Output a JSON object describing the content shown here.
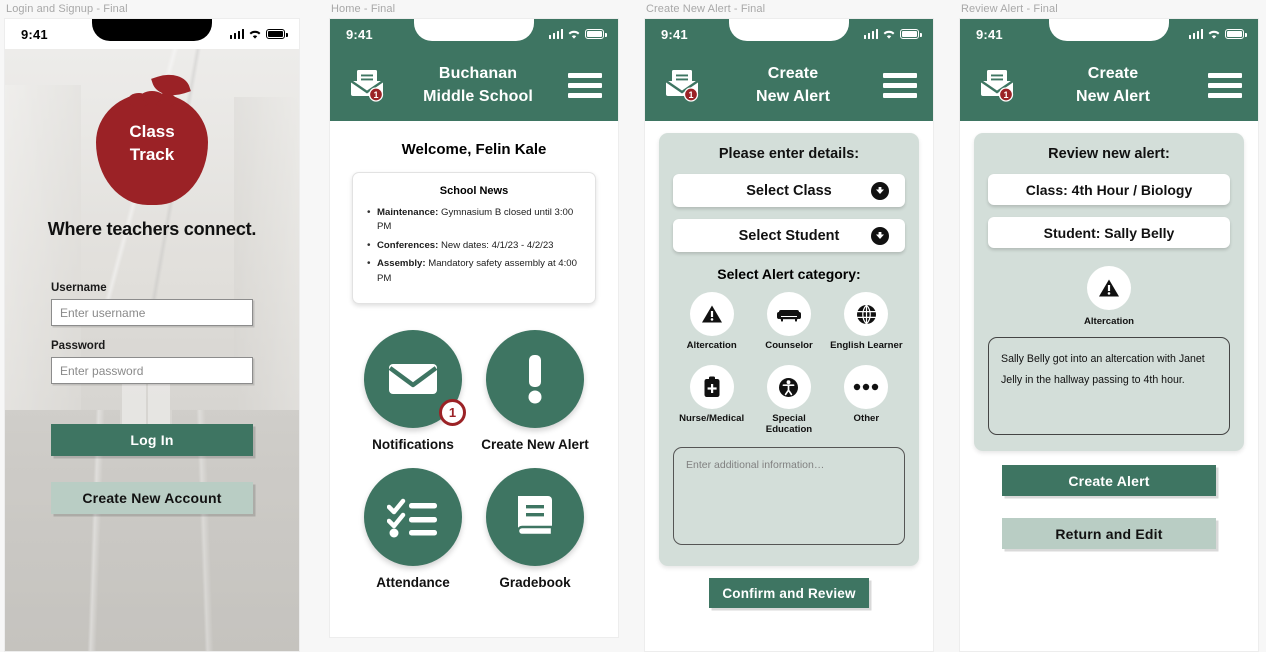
{
  "frames": [
    {
      "title": "Login and Signup - Final"
    },
    {
      "title": "Home - Final"
    },
    {
      "title": "Create New Alert - Final"
    },
    {
      "title": "Review Alert - Final"
    }
  ],
  "status_bar": {
    "time": "9:41"
  },
  "colors": {
    "green": "#3e7562",
    "green_light": "#b9cdc4",
    "panel": "#d3ded9",
    "red": "#9b2226"
  },
  "login": {
    "logo_line1": "Class",
    "logo_line2": "Track",
    "tagline": "Where teachers connect.",
    "username_label": "Username",
    "username_placeholder": "Enter username",
    "password_label": "Password",
    "password_placeholder": "Enter password",
    "login_button": "Log In",
    "create_account_button": "Create New Account"
  },
  "home": {
    "header_line1": "Buchanan",
    "header_line2": "Middle School",
    "welcome": "Welcome, Felin Kale",
    "news_title": "School News",
    "news": [
      {
        "label": "Maintenance:",
        "text": " Gymnasium B closed until 3:00 PM"
      },
      {
        "label": "Conferences:",
        "text": " New dates: 4/1/23 - 4/2/23"
      },
      {
        "label": "Assembly:",
        "text": " Mandatory safety assembly at 4:00 PM"
      }
    ],
    "tiles": [
      {
        "label": "Notifications",
        "icon": "envelope-icon",
        "badge": "1"
      },
      {
        "label": "Create New Alert",
        "icon": "exclamation-icon",
        "badge": ""
      },
      {
        "label": "Attendance",
        "icon": "checklist-icon",
        "badge": ""
      },
      {
        "label": "Gradebook",
        "icon": "book-icon",
        "badge": ""
      }
    ]
  },
  "create_alert": {
    "header_line1": "Create",
    "header_line2": "New Alert",
    "panel_title": "Please enter details:",
    "select_class": "Select Class",
    "select_student": "Select Student",
    "category_heading": "Select Alert category:",
    "categories": [
      {
        "label": "Altercation",
        "icon": "warning-triangle-icon"
      },
      {
        "label": "Counselor",
        "icon": "couch-icon"
      },
      {
        "label": "English Learner",
        "icon": "globe-icon"
      },
      {
        "label": "Nurse/Medical",
        "icon": "medical-clipboard-icon"
      },
      {
        "label": "Special Education",
        "icon": "accessibility-icon"
      },
      {
        "label": "Other",
        "icon": "ellipsis-icon"
      }
    ],
    "notes_placeholder": "Enter additional information…",
    "confirm_button": "Confirm and Review"
  },
  "review_alert": {
    "header_line1": "Create",
    "header_line2": "New Alert",
    "panel_title": "Review new alert:",
    "class_value": "Class: 4th Hour / Biology",
    "student_value": "Student: Sally Belly",
    "category_label": "Altercation",
    "category_icon": "warning-triangle-icon",
    "alert_text": "Sally Belly got into an altercation with Janet Jelly in the hallway passing to 4th hour.",
    "create_button": "Create Alert",
    "return_button": "Return and Edit"
  },
  "badge_count": "1"
}
